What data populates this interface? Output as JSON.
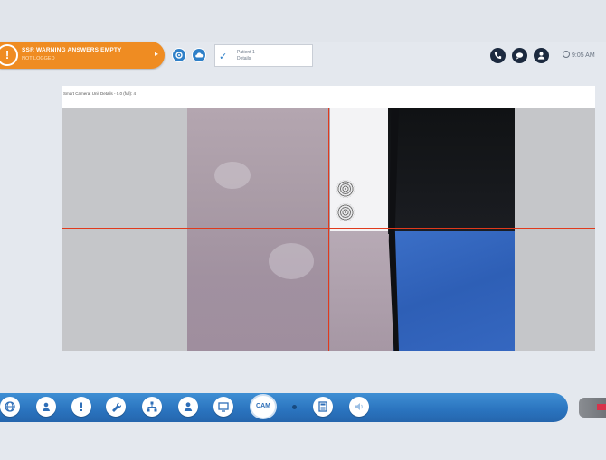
{
  "header": {
    "warning_number": "!",
    "warning_title": "SSR WARNING ANSWERS EMPTY",
    "warning_subtitle": "NOT LOGGED",
    "patient_name": "Patient 1",
    "patient_info": "Details",
    "clock_time": "9:05 AM"
  },
  "panel": {
    "title": "Smart Camera: Unit Details - 0.0 (full): 4"
  },
  "toolbar": {
    "cam_label": "CAM"
  },
  "colors": {
    "warning": "#ef8c22",
    "toolbar_blue": "#2a73be",
    "reticle": "#e03a1c",
    "dark_button": "#1c2a3f"
  }
}
